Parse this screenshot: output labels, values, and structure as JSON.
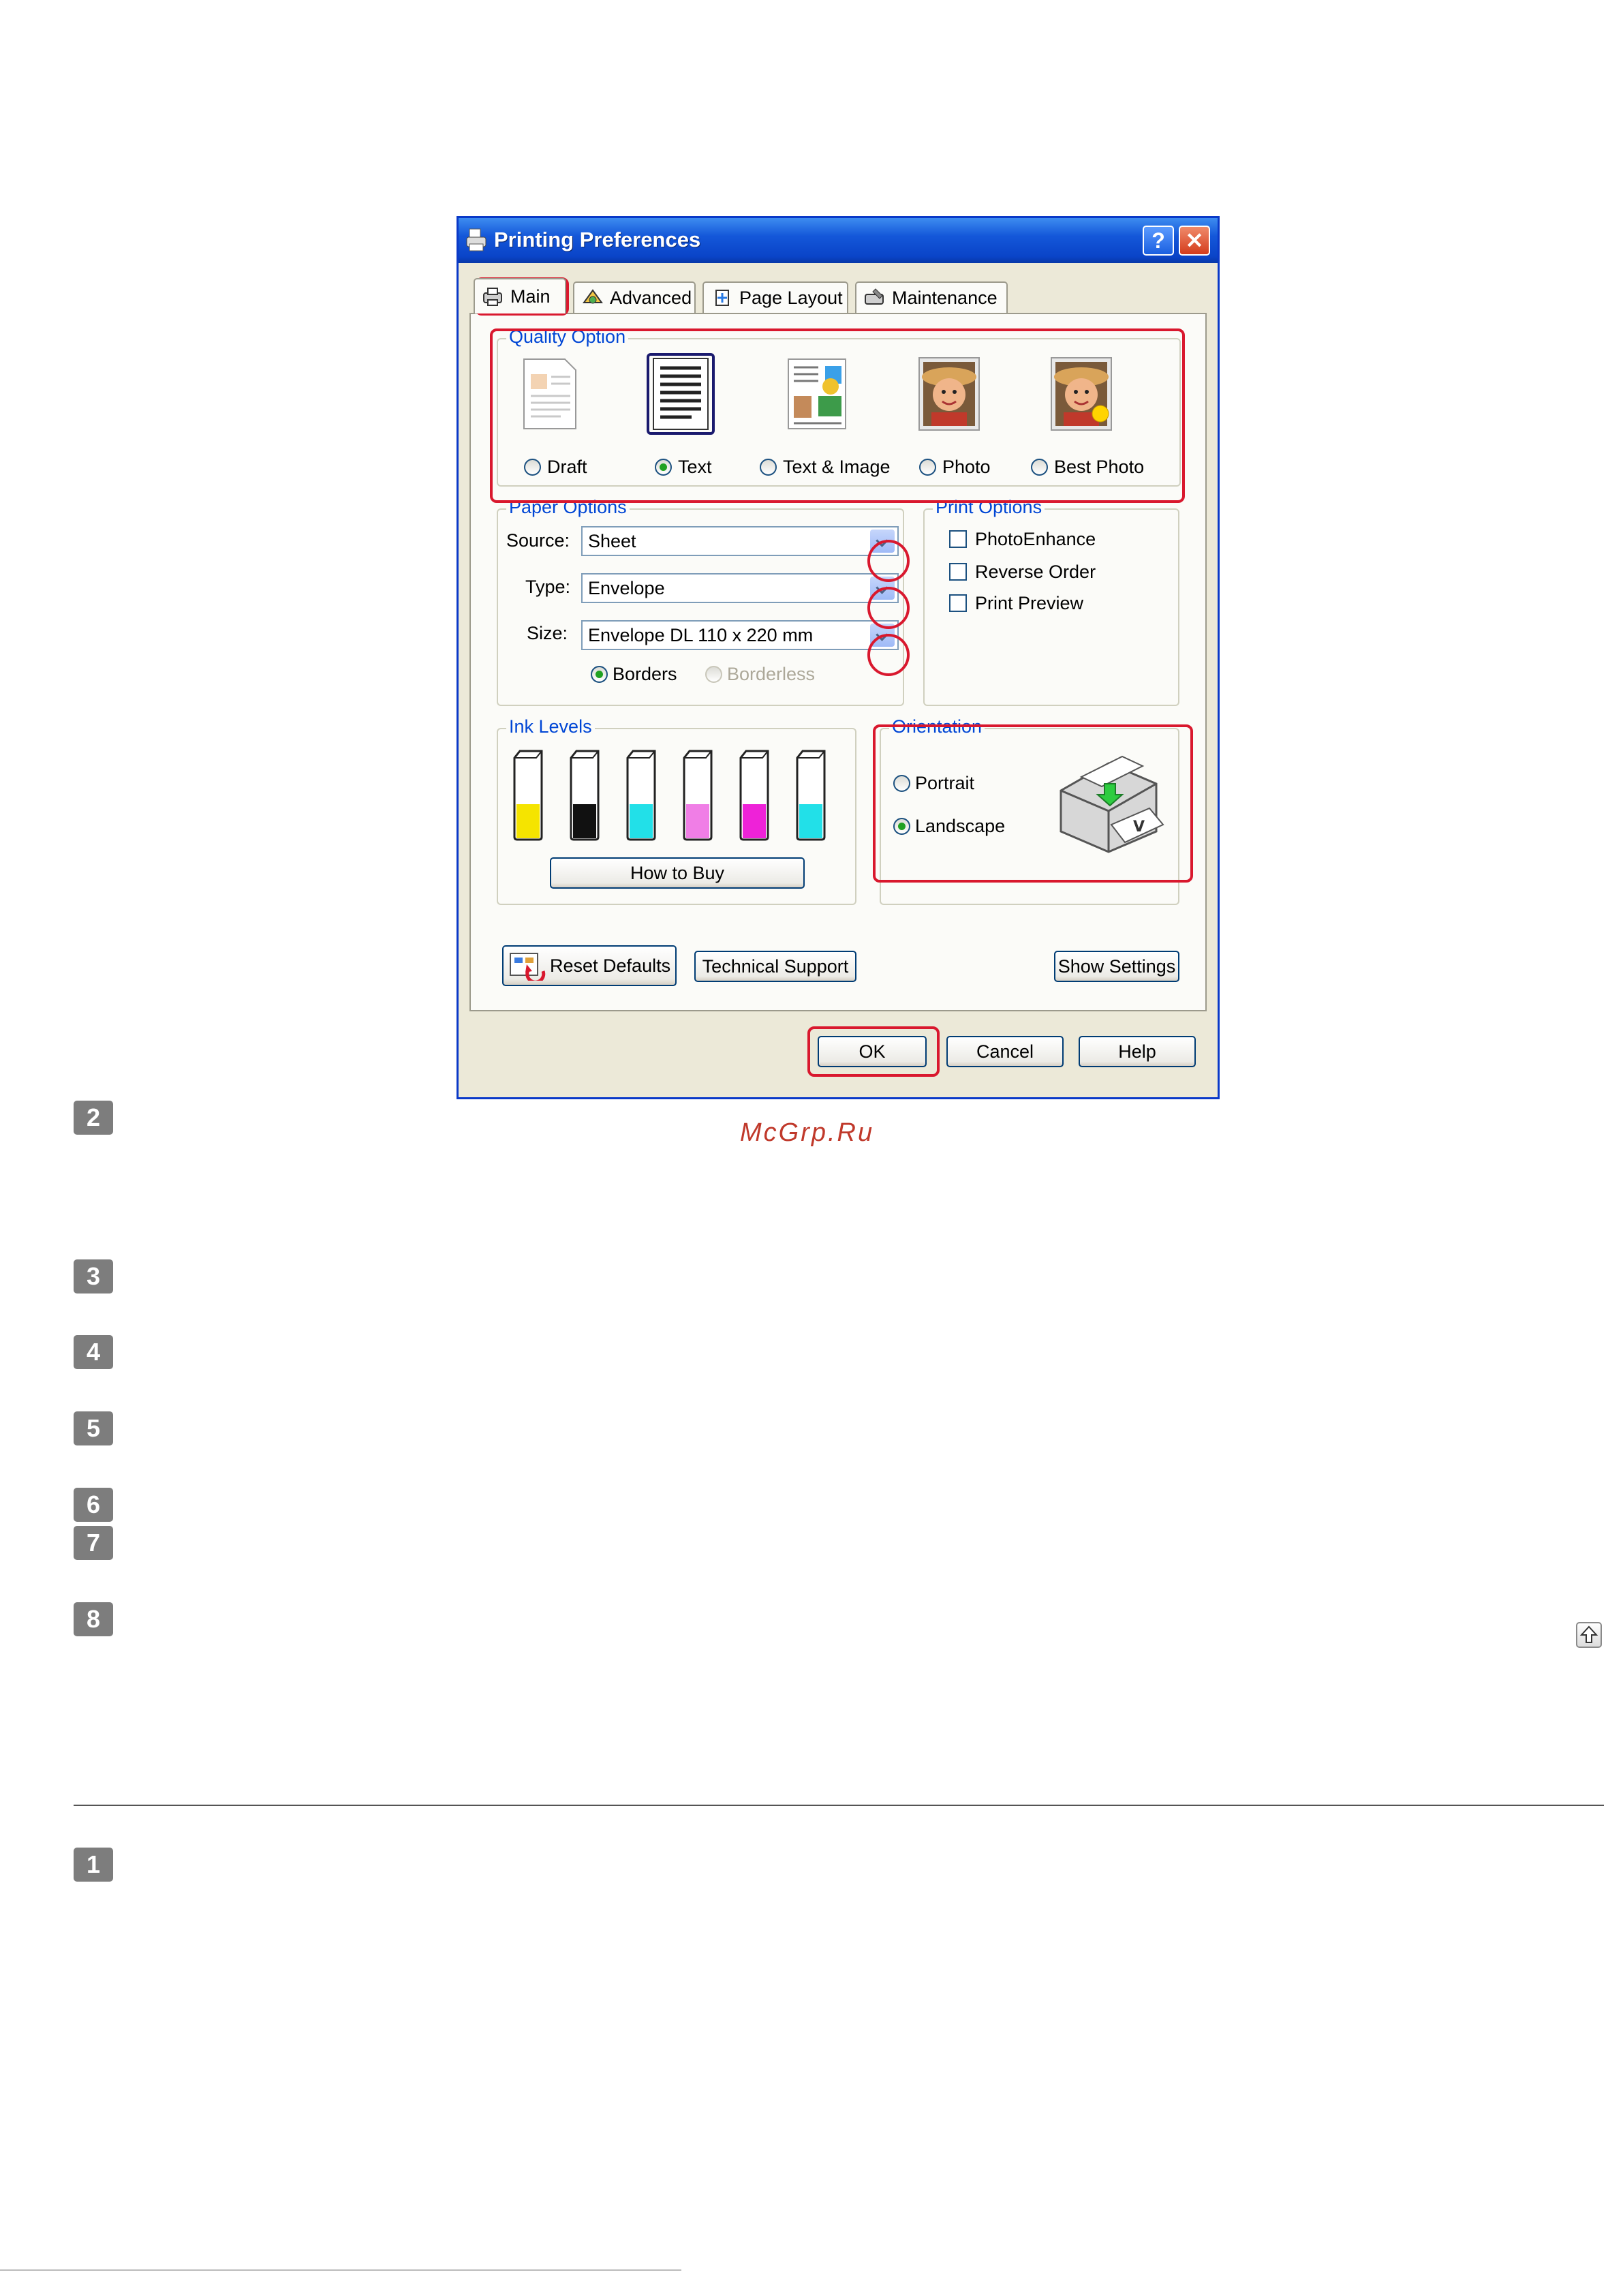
{
  "dialog": {
    "title": "Printing Preferences",
    "help_glyph": "?",
    "close_glyph": "✕",
    "tabs": [
      "Main",
      "Advanced",
      "Page Layout",
      "Maintenance"
    ],
    "selected_tab": "Main",
    "quality": {
      "legend": "Quality Option",
      "options": [
        "Draft",
        "Text",
        "Text & Image",
        "Photo",
        "Best Photo"
      ],
      "selected": "Text"
    },
    "paper": {
      "legend": "Paper Options",
      "source_label": "Source:",
      "source_value": "Sheet",
      "type_label": "Type:",
      "type_value": "Envelope",
      "size_label": "Size:",
      "size_value": "Envelope DL  110 x 220 mm",
      "borders_label": "Borders",
      "borderless_label": "Borderless"
    },
    "print_options": {
      "legend": "Print Options",
      "items": [
        "PhotoEnhance",
        "Reverse Order",
        "Print Preview"
      ]
    },
    "ink": {
      "legend": "Ink Levels",
      "how_to_buy": "How to Buy",
      "tanks": [
        {
          "color": "#f5e400",
          "level": 0.45
        },
        {
          "color": "#111111",
          "level": 0.45
        },
        {
          "color": "#22e0e8",
          "level": 0.45
        },
        {
          "color": "#f07ee6",
          "level": 0.45
        },
        {
          "color": "#ee22d8",
          "level": 0.45
        },
        {
          "color": "#22e0e8",
          "level": 0.45
        }
      ]
    },
    "orientation": {
      "legend": "Orientation",
      "portrait": "Portrait",
      "landscape": "Landscape",
      "selected": "Landscape"
    },
    "buttons": {
      "reset_defaults": "Reset Defaults",
      "technical_support": "Technical Support",
      "show_settings": "Show Settings",
      "ok": "OK",
      "cancel": "Cancel",
      "help": "Help"
    }
  },
  "page": {
    "watermark": "McGrp.Ru",
    "steps": [
      "2",
      "3",
      "4",
      "5",
      "6",
      "7",
      "8",
      "1"
    ]
  },
  "colors": {
    "highlight": "#d9182e",
    "legend_blue": "#0046d5",
    "titlebar": "#0a44c8"
  }
}
